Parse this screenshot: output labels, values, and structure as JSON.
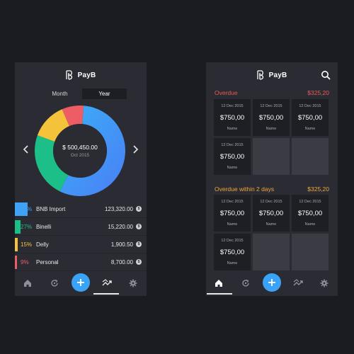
{
  "colors": {
    "background": "#1b1c22",
    "card": "#2b2c33",
    "accent_blue": "#3aa3f5",
    "overdue_red": "#e65b55",
    "warning_orange": "#f0a53a"
  },
  "left_screen": {
    "brand": "PayB",
    "period_options": [
      "Month",
      "Year"
    ],
    "active_period": "Year",
    "total": "$ 500,450.00",
    "date": "Oct 2015",
    "categories": [
      {
        "pct": "65%",
        "name": "BNB Import",
        "amount": "123,320.00",
        "share": 0.65,
        "color": "#3fa2f6",
        "pct_color": "#3fa2f6"
      },
      {
        "pct": "27%",
        "name": "Binelli",
        "amount": "15,220.00",
        "share": 0.27,
        "color": "#1dbf88",
        "pct_color": "#1dbf88"
      },
      {
        "pct": "15%",
        "name": "Delly",
        "amount": "1,900.50",
        "share": 0.15,
        "color": "#f5c33a",
        "pct_color": "#f5c33a"
      },
      {
        "pct": "9%",
        "name": "Personal",
        "amount": "8,700.00",
        "share": 0.09,
        "color": "#ee5c64",
        "pct_color": "#ee5c64"
      }
    ],
    "coin_symbol": "$",
    "nav": [
      "home-icon",
      "refresh-icon",
      "add-icon",
      "chart-icon",
      "settings-icon"
    ],
    "active_nav": "chart-icon"
  },
  "right_screen": {
    "brand": "PayB",
    "sections": [
      {
        "title": "Overdue",
        "total": "$325,20",
        "color": "#e65b55",
        "tiles": [
          {
            "date": "12 Dec 2015",
            "amount": "$750,00",
            "name": "Name"
          },
          {
            "date": "12 Dec 2015",
            "amount": "$750,00",
            "name": "Name"
          },
          {
            "date": "12 Dec 2015",
            "amount": "$750,00",
            "name": "Name"
          },
          {
            "date": "12 Dec 2015",
            "amount": "$750,00",
            "name": "Name"
          }
        ]
      },
      {
        "title": "Overdue within 2 days",
        "total": "$325,20",
        "color": "#f0a53a",
        "tiles": [
          {
            "date": "12 Dec 2015",
            "amount": "$750,00",
            "name": "Name"
          },
          {
            "date": "12 Dec 2015",
            "amount": "$750,00",
            "name": "Name"
          },
          {
            "date": "12 Dec 2015",
            "amount": "$750,00",
            "name": "Name"
          },
          {
            "date": "12 Dec 2015",
            "amount": "$750,00",
            "name": "Name"
          }
        ]
      }
    ],
    "nav": [
      "home-icon",
      "refresh-icon",
      "add-icon",
      "chart-icon",
      "settings-icon"
    ],
    "active_nav": "home-icon"
  }
}
